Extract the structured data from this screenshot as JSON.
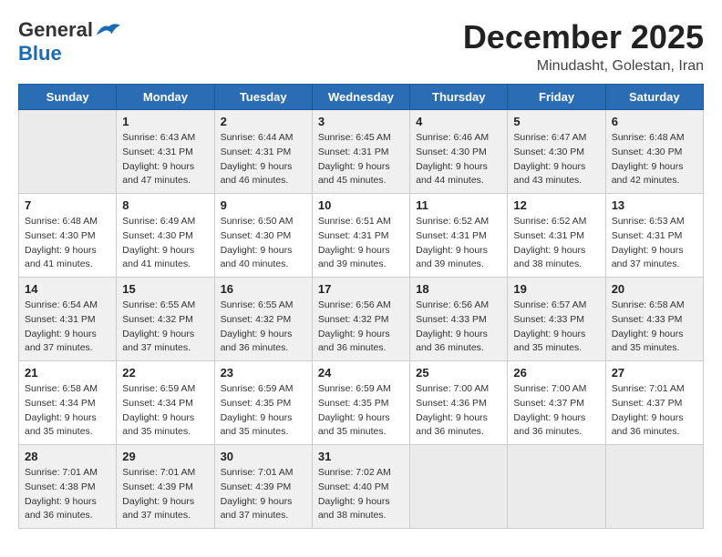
{
  "header": {
    "logo_general": "General",
    "logo_blue": "Blue",
    "month": "December 2025",
    "location": "Minudasht, Golestan, Iran"
  },
  "weekdays": [
    "Sunday",
    "Monday",
    "Tuesday",
    "Wednesday",
    "Thursday",
    "Friday",
    "Saturday"
  ],
  "weeks": [
    [
      {
        "day": "",
        "info": ""
      },
      {
        "day": "1",
        "info": "Sunrise: 6:43 AM\nSunset: 4:31 PM\nDaylight: 9 hours\nand 47 minutes."
      },
      {
        "day": "2",
        "info": "Sunrise: 6:44 AM\nSunset: 4:31 PM\nDaylight: 9 hours\nand 46 minutes."
      },
      {
        "day": "3",
        "info": "Sunrise: 6:45 AM\nSunset: 4:31 PM\nDaylight: 9 hours\nand 45 minutes."
      },
      {
        "day": "4",
        "info": "Sunrise: 6:46 AM\nSunset: 4:30 PM\nDaylight: 9 hours\nand 44 minutes."
      },
      {
        "day": "5",
        "info": "Sunrise: 6:47 AM\nSunset: 4:30 PM\nDaylight: 9 hours\nand 43 minutes."
      },
      {
        "day": "6",
        "info": "Sunrise: 6:48 AM\nSunset: 4:30 PM\nDaylight: 9 hours\nand 42 minutes."
      }
    ],
    [
      {
        "day": "7",
        "info": "Sunrise: 6:48 AM\nSunset: 4:30 PM\nDaylight: 9 hours\nand 41 minutes."
      },
      {
        "day": "8",
        "info": "Sunrise: 6:49 AM\nSunset: 4:30 PM\nDaylight: 9 hours\nand 41 minutes."
      },
      {
        "day": "9",
        "info": "Sunrise: 6:50 AM\nSunset: 4:30 PM\nDaylight: 9 hours\nand 40 minutes."
      },
      {
        "day": "10",
        "info": "Sunrise: 6:51 AM\nSunset: 4:31 PM\nDaylight: 9 hours\nand 39 minutes."
      },
      {
        "day": "11",
        "info": "Sunrise: 6:52 AM\nSunset: 4:31 PM\nDaylight: 9 hours\nand 39 minutes."
      },
      {
        "day": "12",
        "info": "Sunrise: 6:52 AM\nSunset: 4:31 PM\nDaylight: 9 hours\nand 38 minutes."
      },
      {
        "day": "13",
        "info": "Sunrise: 6:53 AM\nSunset: 4:31 PM\nDaylight: 9 hours\nand 37 minutes."
      }
    ],
    [
      {
        "day": "14",
        "info": "Sunrise: 6:54 AM\nSunset: 4:31 PM\nDaylight: 9 hours\nand 37 minutes."
      },
      {
        "day": "15",
        "info": "Sunrise: 6:55 AM\nSunset: 4:32 PM\nDaylight: 9 hours\nand 37 minutes."
      },
      {
        "day": "16",
        "info": "Sunrise: 6:55 AM\nSunset: 4:32 PM\nDaylight: 9 hours\nand 36 minutes."
      },
      {
        "day": "17",
        "info": "Sunrise: 6:56 AM\nSunset: 4:32 PM\nDaylight: 9 hours\nand 36 minutes."
      },
      {
        "day": "18",
        "info": "Sunrise: 6:56 AM\nSunset: 4:33 PM\nDaylight: 9 hours\nand 36 minutes."
      },
      {
        "day": "19",
        "info": "Sunrise: 6:57 AM\nSunset: 4:33 PM\nDaylight: 9 hours\nand 35 minutes."
      },
      {
        "day": "20",
        "info": "Sunrise: 6:58 AM\nSunset: 4:33 PM\nDaylight: 9 hours\nand 35 minutes."
      }
    ],
    [
      {
        "day": "21",
        "info": "Sunrise: 6:58 AM\nSunset: 4:34 PM\nDaylight: 9 hours\nand 35 minutes."
      },
      {
        "day": "22",
        "info": "Sunrise: 6:59 AM\nSunset: 4:34 PM\nDaylight: 9 hours\nand 35 minutes."
      },
      {
        "day": "23",
        "info": "Sunrise: 6:59 AM\nSunset: 4:35 PM\nDaylight: 9 hours\nand 35 minutes."
      },
      {
        "day": "24",
        "info": "Sunrise: 6:59 AM\nSunset: 4:35 PM\nDaylight: 9 hours\nand 35 minutes."
      },
      {
        "day": "25",
        "info": "Sunrise: 7:00 AM\nSunset: 4:36 PM\nDaylight: 9 hours\nand 36 minutes."
      },
      {
        "day": "26",
        "info": "Sunrise: 7:00 AM\nSunset: 4:37 PM\nDaylight: 9 hours\nand 36 minutes."
      },
      {
        "day": "27",
        "info": "Sunrise: 7:01 AM\nSunset: 4:37 PM\nDaylight: 9 hours\nand 36 minutes."
      }
    ],
    [
      {
        "day": "28",
        "info": "Sunrise: 7:01 AM\nSunset: 4:38 PM\nDaylight: 9 hours\nand 36 minutes."
      },
      {
        "day": "29",
        "info": "Sunrise: 7:01 AM\nSunset: 4:39 PM\nDaylight: 9 hours\nand 37 minutes."
      },
      {
        "day": "30",
        "info": "Sunrise: 7:01 AM\nSunset: 4:39 PM\nDaylight: 9 hours\nand 37 minutes."
      },
      {
        "day": "31",
        "info": "Sunrise: 7:02 AM\nSunset: 4:40 PM\nDaylight: 9 hours\nand 38 minutes."
      },
      {
        "day": "",
        "info": ""
      },
      {
        "day": "",
        "info": ""
      },
      {
        "day": "",
        "info": ""
      }
    ]
  ]
}
